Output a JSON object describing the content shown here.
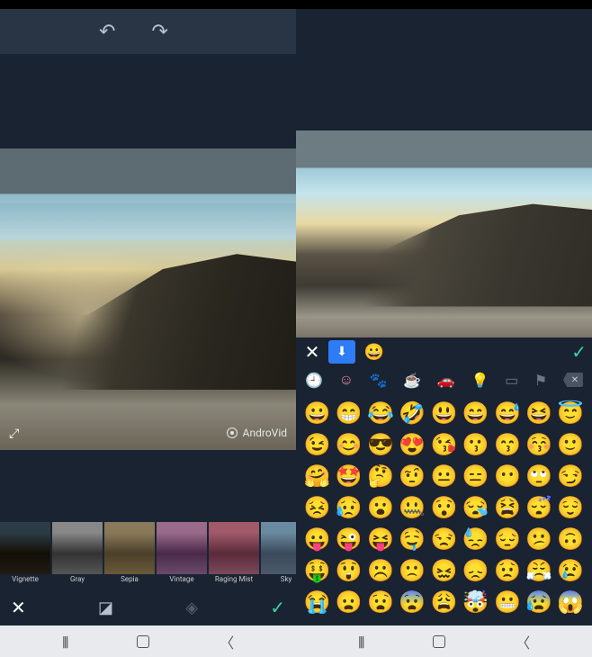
{
  "left": {
    "watermark": "AndroVid",
    "filters": [
      {
        "label": "Vignette"
      },
      {
        "label": "Gray"
      },
      {
        "label": "Sepia"
      },
      {
        "label": "Vintage"
      },
      {
        "label": "Raging Mist"
      },
      {
        "label": "Sky"
      }
    ]
  },
  "right": {
    "toolbar": {
      "sample_emoji": "😀"
    },
    "categories": [
      "recent",
      "smileys",
      "animals",
      "food",
      "travel",
      "objects",
      "symbols",
      "flags"
    ],
    "emojis": [
      "😀",
      "😁",
      "😂",
      "🤣",
      "😃",
      "😄",
      "😅",
      "😆",
      "😇",
      "😉",
      "😊",
      "😎",
      "😍",
      "😘",
      "😗",
      "😙",
      "😚",
      "🙂",
      "🤗",
      "🤩",
      "🤔",
      "🤨",
      "😐",
      "😑",
      "😶",
      "🙄",
      "😏",
      "😣",
      "😥",
      "😮",
      "🤐",
      "😯",
      "😪",
      "😫",
      "😴",
      "😌",
      "😛",
      "😜",
      "😝",
      "🤤",
      "😒",
      "😓",
      "😔",
      "😕",
      "🙃",
      "🤑",
      "😲",
      "☹️",
      "🙁",
      "😖",
      "😞",
      "😟",
      "😤",
      "😢",
      "😭",
      "😦",
      "😧",
      "😨",
      "😩",
      "🤯",
      "😬",
      "😰",
      "😱"
    ]
  }
}
